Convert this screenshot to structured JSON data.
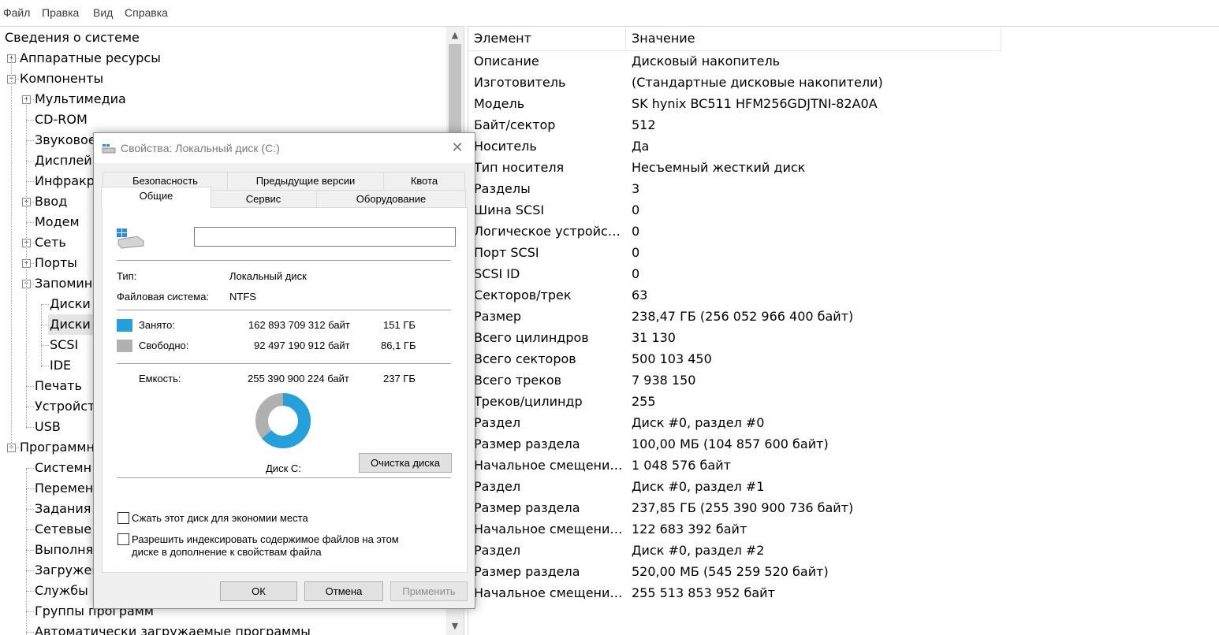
{
  "menu": [
    "Файл",
    "Правка",
    "Вид",
    "Справка"
  ],
  "tree": [
    {
      "label": "Сведения о системе",
      "indent": 0,
      "exp": ""
    },
    {
      "label": "Аппаратные ресурсы",
      "indent": 1,
      "exp": "+"
    },
    {
      "label": "Компоненты",
      "indent": 1,
      "exp": "-"
    },
    {
      "label": "Мультимедиа",
      "indent": 2,
      "exp": "+"
    },
    {
      "label": "CD-ROM",
      "indent": 2,
      "exp": ""
    },
    {
      "label": "Звуковое",
      "indent": 2,
      "exp": ""
    },
    {
      "label": "Дисплей",
      "indent": 2,
      "exp": ""
    },
    {
      "label": "Инфракра",
      "indent": 2,
      "exp": ""
    },
    {
      "label": "Ввод",
      "indent": 2,
      "exp": "+"
    },
    {
      "label": "Модем",
      "indent": 2,
      "exp": ""
    },
    {
      "label": "Сеть",
      "indent": 2,
      "exp": "+"
    },
    {
      "label": "Порты",
      "indent": 2,
      "exp": "+"
    },
    {
      "label": "Запомина",
      "indent": 2,
      "exp": "-"
    },
    {
      "label": "Диски",
      "indent": 3,
      "exp": ""
    },
    {
      "label": "Диски",
      "indent": 3,
      "exp": "",
      "selected": true
    },
    {
      "label": "SCSI",
      "indent": 3,
      "exp": ""
    },
    {
      "label": "IDE",
      "indent": 3,
      "exp": ""
    },
    {
      "label": "Печать",
      "indent": 2,
      "exp": ""
    },
    {
      "label": "Устройств",
      "indent": 2,
      "exp": ""
    },
    {
      "label": "USB",
      "indent": 2,
      "exp": ""
    },
    {
      "label": "Программн",
      "indent": 1,
      "exp": "-"
    },
    {
      "label": "Системн",
      "indent": 2,
      "exp": ""
    },
    {
      "label": "Переменн",
      "indent": 2,
      "exp": ""
    },
    {
      "label": "Задания д",
      "indent": 2,
      "exp": ""
    },
    {
      "label": "Сетевые п",
      "indent": 2,
      "exp": ""
    },
    {
      "label": "Выполняе",
      "indent": 2,
      "exp": ""
    },
    {
      "label": "Загружен",
      "indent": 2,
      "exp": ""
    },
    {
      "label": "Службы",
      "indent": 2,
      "exp": ""
    },
    {
      "label": "Группы программ",
      "indent": 2,
      "exp": ""
    },
    {
      "label": "Автоматически загружаемые программы",
      "indent": 2,
      "exp": ""
    }
  ],
  "list": {
    "headers": [
      "Элемент",
      "Значение"
    ],
    "rows": [
      [
        "Описание",
        "Дисковый накопитель"
      ],
      [
        "Изготовитель",
        "(Стандартные дисковые накопители)"
      ],
      [
        "Модель",
        "SK hynix BC511 HFM256GDJTNI-82A0A"
      ],
      [
        "Байт/сектор",
        "512"
      ],
      [
        "Носитель",
        "Да"
      ],
      [
        "Тип носителя",
        "Несъемный жесткий диск"
      ],
      [
        "Разделы",
        "3"
      ],
      [
        "Шина SCSI",
        "0"
      ],
      [
        "Логическое устройств...",
        "0"
      ],
      [
        "Порт SCSI",
        "0"
      ],
      [
        "SCSI ID",
        "0"
      ],
      [
        "Секторов/трек",
        "63"
      ],
      [
        "Размер",
        "238,47 ГБ (256 052 966 400 байт)"
      ],
      [
        "Всего цилиндров",
        "31 130"
      ],
      [
        "Всего секторов",
        "500 103 450"
      ],
      [
        "Всего треков",
        "7 938 150"
      ],
      [
        "Треков/цилиндр",
        "255"
      ],
      [
        "Раздел",
        "Диск #0, раздел #0"
      ],
      [
        "Размер раздела",
        "100,00 МБ (104 857 600 байт)"
      ],
      [
        "Начальное смещение ...",
        "1 048 576 байт"
      ],
      [
        "Раздел",
        "Диск #0, раздел #1"
      ],
      [
        "Размер раздела",
        "237,85 ГБ (255 390 900 736 байт)"
      ],
      [
        "Начальное смещение ...",
        "122 683 392 байт"
      ],
      [
        "Раздел",
        "Диск #0, раздел #2"
      ],
      [
        "Размер раздела",
        "520,00 МБ (545 259 520 байт)"
      ],
      [
        "Начальное смещение ...",
        "255 513 853 952 байт"
      ]
    ]
  },
  "dialog": {
    "title": "Свойства: Локальный диск (C:)",
    "tabs_back": [
      "Безопасность",
      "Предыдущие версии",
      "Квота"
    ],
    "tabs_front": [
      "Общие",
      "Сервис",
      "Оборудование"
    ],
    "name_value": "",
    "type_label": "Тип:",
    "type_value": "Локальный диск",
    "fs_label": "Файловая система:",
    "fs_value": "NTFS",
    "used_label": "Занято:",
    "used_bytes": "162 893 709 312 байт",
    "used_gb": "151 ГБ",
    "free_label": "Свободно:",
    "free_bytes": "92 497 190 912 байт",
    "free_gb": "86,1 ГБ",
    "cap_label": "Емкость:",
    "cap_bytes": "255 390 900 224 байт",
    "cap_gb": "237 ГБ",
    "used_fraction": 0.638,
    "used_color": "#26a0da",
    "free_color": "#b0b0b0",
    "disk_label": "Диск C:",
    "cleanup_button": "Очистка диска",
    "compress_label": "Сжать этот диск для экономии места",
    "index_label_1": "Разрешить индексировать содержимое файлов на этом",
    "index_label_2": "диске в дополнение к свойствам файла",
    "ok": "ОК",
    "cancel": "Отмена",
    "apply": "Применить"
  }
}
